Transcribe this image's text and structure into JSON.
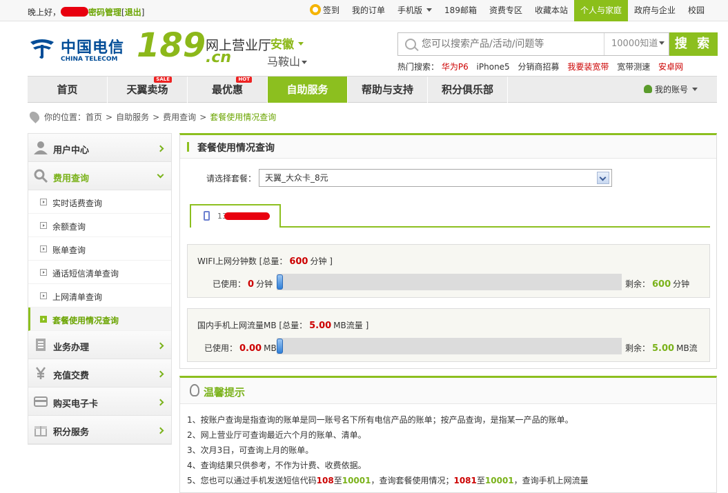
{
  "topbar": {
    "greeting": "晚上好，",
    "pwd_manage": "密码管理",
    "logout": "退出",
    "links": [
      {
        "label": "签到",
        "icon": "sign-icon"
      },
      {
        "label": "我的订单"
      },
      {
        "label": "手机版",
        "dropdown": true
      },
      {
        "label": "189邮箱"
      },
      {
        "label": "资费专区"
      },
      {
        "label": "收藏本站"
      },
      {
        "label": "个人与家庭",
        "active": true
      },
      {
        "label": "政府与企业"
      },
      {
        "label": "校园"
      }
    ]
  },
  "header": {
    "logo_cn": "中国电信",
    "logo_en": "CHINA TELECOM",
    "brand": "189",
    "brand_suffix": ".cn",
    "subtitle": "网上营业厅",
    "province": "安徽",
    "city": "马鞍山",
    "search_placeholder": "您可以搜索产品/活动/问题等",
    "search_scope": "10000知道",
    "search_button": "搜 索",
    "hot_label": "热门搜索：",
    "hot_terms": [
      {
        "text": "华为P6",
        "red": true
      },
      {
        "text": "iPhone5",
        "red": false
      },
      {
        "text": "分销商招募",
        "red": false
      },
      {
        "text": "我要装宽带",
        "red": true
      },
      {
        "text": "宽带测速",
        "red": false
      },
      {
        "text": "安卓网",
        "red": true
      }
    ]
  },
  "nav": {
    "items": [
      {
        "label": "首页"
      },
      {
        "label": "天翼卖场",
        "badge": "SALE"
      },
      {
        "label": "最优惠",
        "badge": "HOT"
      },
      {
        "label": "自助服务",
        "active": true
      },
      {
        "label": "帮助与支持"
      },
      {
        "label": "积分俱乐部"
      }
    ],
    "account": "我的账号"
  },
  "breadcrumb": {
    "prefix": "你的位置：",
    "items": [
      "首页",
      "自助服务",
      "费用查询"
    ],
    "current": "套餐使用情况查询"
  },
  "sidebar": {
    "groups_top": [
      {
        "label": "用户中心",
        "icon": "user-icon"
      },
      {
        "label": "费用查询",
        "icon": "search-icon",
        "open": true
      }
    ],
    "subitems": [
      {
        "label": "实时话费查询"
      },
      {
        "label": "余额查询"
      },
      {
        "label": "账单查询"
      },
      {
        "label": "通话短信清单查询"
      },
      {
        "label": "上网清单查询"
      },
      {
        "label": "套餐使用情况查询",
        "active": true
      }
    ],
    "groups_bottom": [
      {
        "label": "业务办理",
        "icon": "document-icon"
      },
      {
        "label": "充值交费",
        "icon": "yuan-icon"
      },
      {
        "label": "购买电子卡",
        "icon": "card-icon"
      },
      {
        "label": "积分服务",
        "icon": "gift-icon"
      }
    ]
  },
  "main": {
    "title": "套餐使用情况查询",
    "select_label": "请选择套餐：",
    "select_value": "天翼_大众卡_8元",
    "tab_number_prefix": "13",
    "usage": [
      {
        "title": "WIFI上网分钟数 [总量：",
        "total": "600",
        "title_suffix": "分钟 ]",
        "used_label": "已使用：",
        "used": "0",
        "used_unit": "分钟",
        "remain_label": "剩余：",
        "remain": "600",
        "remain_unit": "分钟",
        "fraction_used": 0
      },
      {
        "title": "国内手机上网流量MB [总量：",
        "total": "5.00",
        "title_suffix": "MB流量 ]",
        "used_label": "已使用：",
        "used": "0.00",
        "used_unit": "MB",
        "remain_label": "剩余：",
        "remain": "5.00",
        "remain_unit": "MB流",
        "fraction_used": 0
      }
    ]
  },
  "tips": {
    "title": "温馨提示",
    "lines": [
      "1、按账户查询是指查询的账单是同一账号名下所有电信产品的账单；按产品查询，是指某一产品的账单。",
      "2、网上营业厅可查询最近六个月的账单、清单。",
      "3、次月3日，可查询上月的账单。",
      "4、查询结果只供参考，不作为计费、收费依据。"
    ],
    "line5": {
      "a": "5、您也可以通过手机发送短信代码",
      "code1": "108",
      "b": "至",
      "num1": "10001",
      "c": "，查询套餐使用情况；",
      "code2": "1081",
      "d": "至",
      "num2": "10001",
      "e": "，查询手机上网流量"
    }
  },
  "colors": {
    "accent": "#8cbf1f",
    "value_red": "#c00",
    "brand_blue": "#004c97"
  }
}
